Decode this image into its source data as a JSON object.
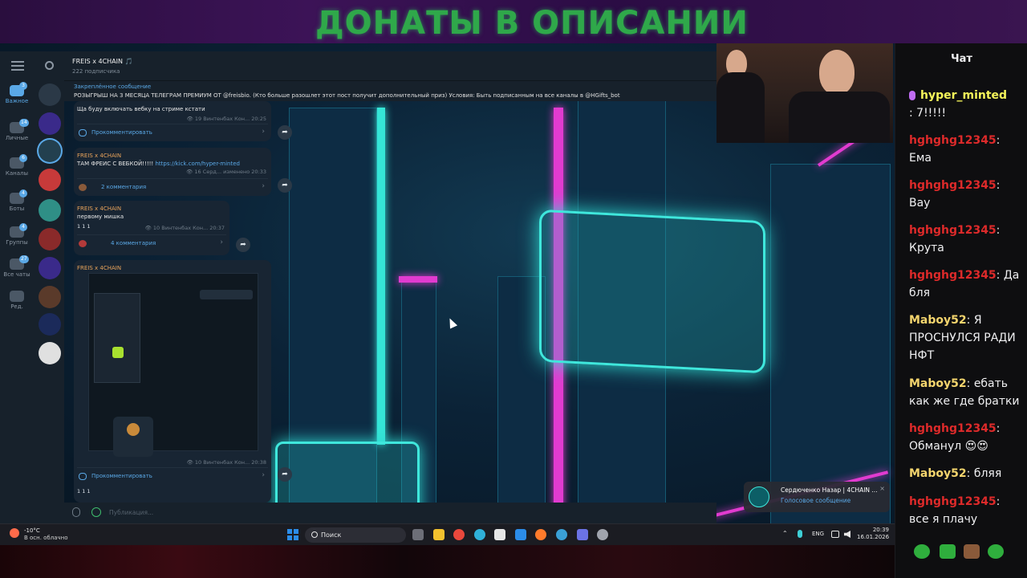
{
  "banner": {
    "text": "ДОНАТЫ В ОПИСАНИИ"
  },
  "telegram": {
    "rail": {
      "items": [
        {
          "label": "Важное",
          "badge": "3"
        },
        {
          "label": "Личные",
          "badge": "14"
        },
        {
          "label": "Каналы",
          "badge": "6"
        },
        {
          "label": "Боты",
          "badge": "4"
        },
        {
          "label": "Группы",
          "badge": "4"
        },
        {
          "label": "Все чаты",
          "badge": "27"
        },
        {
          "label": "Ред."
        }
      ]
    },
    "header": {
      "channel_name": "FREIS x 4CHAIN 🎵",
      "subscribers": "222 подписчика"
    },
    "pinned": {
      "title": "Закреплённое сообщение",
      "text": "РОЗЫГРЫШ НА 3 МЕСЯЦА ТЕЛЕГРАМ ПРЕМИУМ ОТ @freisbio. (Кто больше разошлет этот пост получит дополнительный приз) Условия: Быть подписанным на все каналы в @HGifts_bot"
    },
    "messages": [
      {
        "author": "FREIS x 4CHAIN",
        "text": "Ща буду включать вебку на стриме кстати",
        "views": "19",
        "sender": "Винтенбах Кон...",
        "time": "20:25",
        "comments": "Прокомментировать"
      },
      {
        "author": "FREIS x 4CHAIN",
        "text": "ТАМ ФРЕИС С ВЕБКОЙ!!!!!",
        "link": "https://kick.com/hyper-minted",
        "views": "16",
        "sender": "Серд...",
        "time": "изменено 20:33",
        "comments": "2 комментария"
      },
      {
        "author": "FREIS x 4CHAIN",
        "text": "первому мишка",
        "views": "10",
        "sender": "Винтенбах Кон...",
        "time": "20:37",
        "reactions": "1  1  1",
        "comments": "4 комментария"
      },
      {
        "author": "FREIS x 4CHAIN",
        "views": "10",
        "sender": "Винтенбах Кон...",
        "time": "20:38",
        "reactions": "1  1  1",
        "comments": "Прокомментировать"
      }
    ],
    "compose": {
      "placeholder": "Публикация..."
    }
  },
  "toast": {
    "title": "Сердюченко Назар | 4CHAIN ...",
    "subtitle": "Голосовое сообщение",
    "close": "×"
  },
  "chat": {
    "title": "Чат",
    "messages": [
      {
        "user": "hyper_minted",
        "text": ": 7!!!!!",
        "role": "broadcaster"
      },
      {
        "user": "hghghg12345",
        "text": "Ема"
      },
      {
        "user": "hghghg12345",
        "text": "Вау"
      },
      {
        "user": "hghghg12345",
        "text": "Крута"
      },
      {
        "user": "hghghg12345",
        "text": "Да бля"
      },
      {
        "user": "Maboy52",
        "text": "Я ПРОСНУЛСЯ РАДИ НФТ"
      },
      {
        "user": "Maboy52",
        "text": "ебать как же где братки"
      },
      {
        "user": "hghghg12345",
        "text": "Обманул 😍😍"
      },
      {
        "user": "Maboy52",
        "text": "бляя"
      },
      {
        "user": "hghghg12345",
        "text": "все я плачу"
      }
    ]
  },
  "taskbar": {
    "weather_temp": "-10°C",
    "weather_desc": "В осн. облачно",
    "search_label": "Поиск",
    "lang": "ENG",
    "time": "20:39",
    "date": "16.01.2026"
  },
  "colors": {
    "telegram_bg": "#17212b",
    "accent": "#5aa8e6",
    "chat_user": "#dd2a2a",
    "chat_user_alt": "#f3d46d",
    "broadcaster": "#f5f55a",
    "banner_text": "#2fa84a"
  }
}
